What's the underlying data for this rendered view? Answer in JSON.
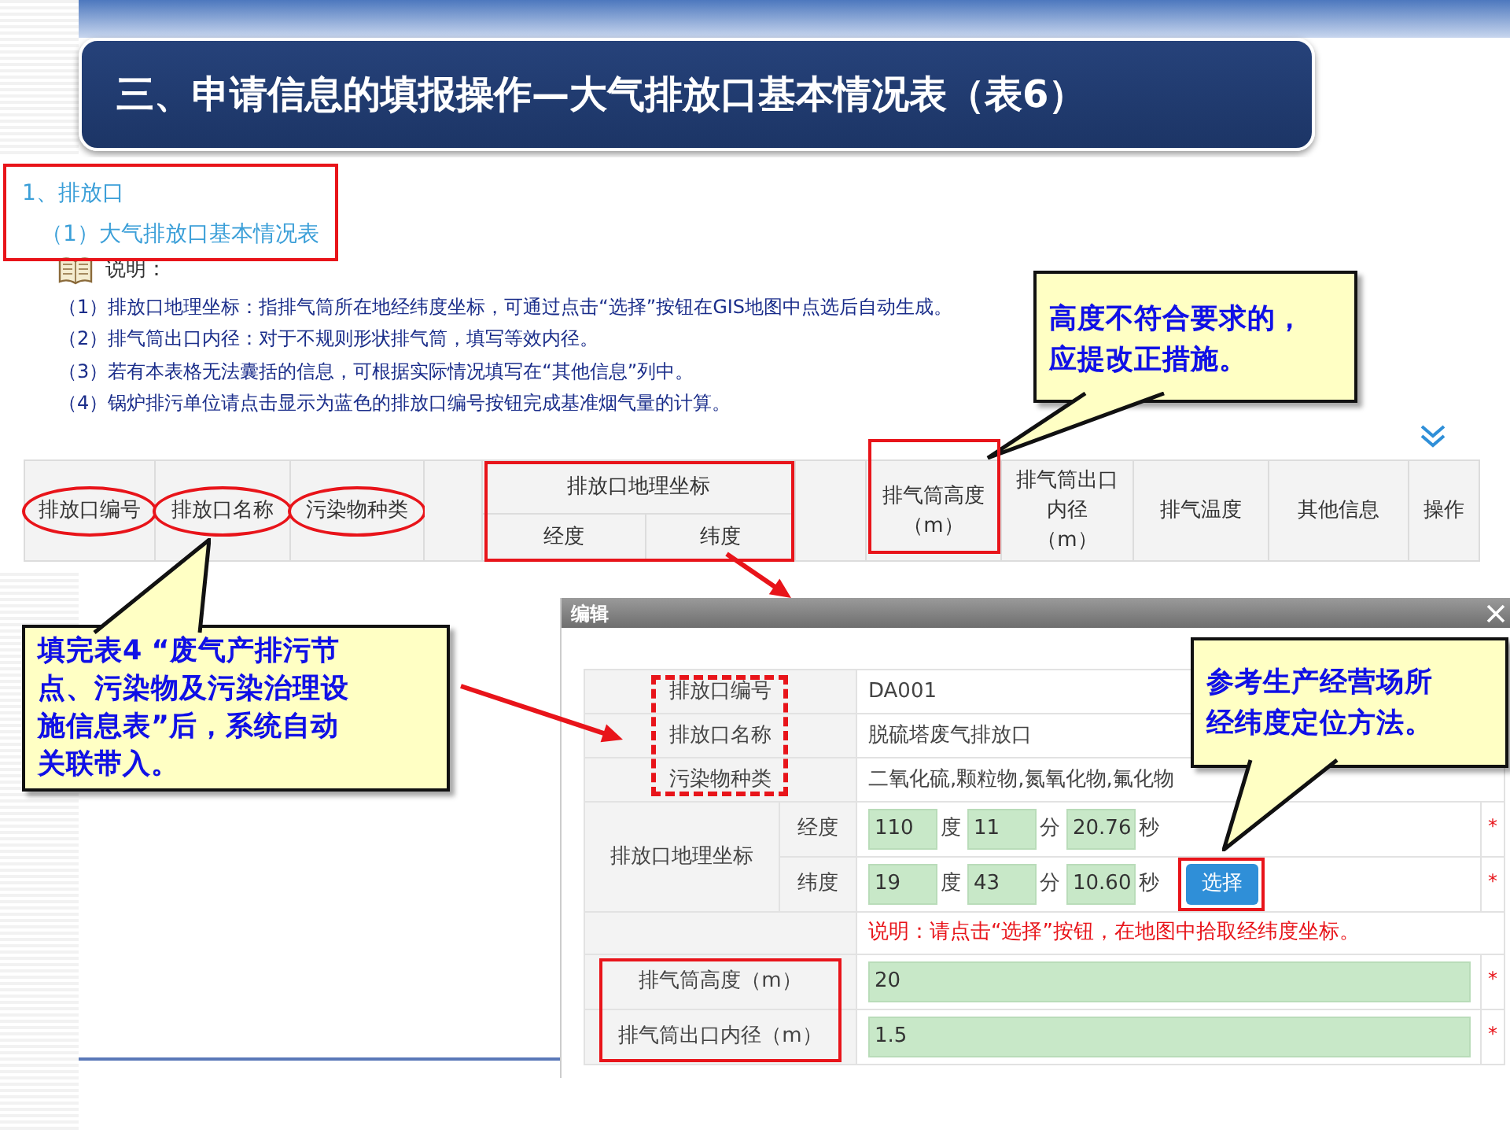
{
  "slide_title": "三、申请信息的填报操作—大气排放口基本情况表（表6）",
  "section": {
    "heading": "1、排放口",
    "subheading": "（1）大气排放口基本情况表",
    "boxed": true
  },
  "notes": {
    "label": "说明：",
    "items": [
      "（1）排放口地理坐标：指排气筒所在地经纬度坐标，可通过点击“选择”按钮在GIS地图中点选后自动生成。",
      "（2）排气筒出口内径：对于不规则形状排气筒，填写等效内径。",
      "（3）若有本表格无法囊括的信息，可根据实际情况填写在“其他信息”列中。",
      "（4）锅炉排污单位请点击显示为蓝色的排放口编号按钮完成基准烟气量的计算。"
    ]
  },
  "table": {
    "columns": [
      {
        "label_lines": [
          "排放口编号"
        ],
        "circled": true
      },
      {
        "label_lines": [
          "排放口名称"
        ],
        "circled": true
      },
      {
        "label_lines": [
          "污染物种类"
        ],
        "circled": true
      },
      {
        "label_lines": [
          "排放口地理坐标"
        ],
        "boxed": true,
        "children": [
          {
            "label_lines": [
              "经度"
            ]
          },
          {
            "label_lines": [
              "纬度"
            ]
          }
        ]
      },
      {
        "label_lines": [
          "排气筒高度",
          "（m）"
        ],
        "boxed": true
      },
      {
        "label_lines": [
          "排气筒出口",
          "内径",
          "（m）"
        ]
      },
      {
        "label_lines": [
          "排气温度"
        ]
      },
      {
        "label_lines": [
          "其他信息"
        ]
      },
      {
        "label_lines": [
          "操作"
        ]
      }
    ]
  },
  "dialog": {
    "title": "编辑",
    "rows": [
      {
        "kind": "text",
        "label": "排放口编号",
        "value": "DA001",
        "dashed_box": true
      },
      {
        "kind": "text",
        "label": "排放口名称",
        "value": "脱硫塔废气排放口",
        "dashed_box": true
      },
      {
        "kind": "text",
        "label": "污染物种类",
        "value": "二氧化硫,颗粒物,氮氧化物,氟化物",
        "dashed_box": true
      },
      {
        "kind": "coord",
        "label": "排放口地理坐标",
        "parts": [
          {
            "label": "经度",
            "required_mark": "*",
            "fields": [
              {
                "value": "110",
                "unit": "度"
              },
              {
                "value": "11",
                "unit": "分"
              },
              {
                "value": "20.76",
                "unit": "秒"
              }
            ]
          },
          {
            "label": "纬度",
            "required_mark": "*",
            "button": "选择",
            "button_boxed": true,
            "fields": [
              {
                "value": "19",
                "unit": "度"
              },
              {
                "value": "43",
                "unit": "分"
              },
              {
                "value": "10.60",
                "unit": "秒"
              }
            ]
          }
        ]
      },
      {
        "kind": "note",
        "value": "说明：请点击“选择”按钮，在地图中拾取经纬度坐标。"
      },
      {
        "kind": "input",
        "label": "排气筒高度（m）",
        "value": "20",
        "required_mark": "*",
        "boxed": true
      },
      {
        "kind": "input",
        "label": "排气筒出口内径（m）",
        "value": "1.5",
        "required_mark": "*",
        "boxed": true
      }
    ]
  },
  "callouts": [
    {
      "lines": [
        "高度不符合要求的，",
        "应提改正措施。"
      ]
    },
    {
      "lines": [
        "填完表4 “废气产排污节",
        "点、污染物及污染治理设",
        "施信息表”后，系统自动",
        "关联带入。"
      ]
    },
    {
      "lines": [
        "参考生产经营场所",
        "经纬度定位方法。"
      ]
    }
  ]
}
